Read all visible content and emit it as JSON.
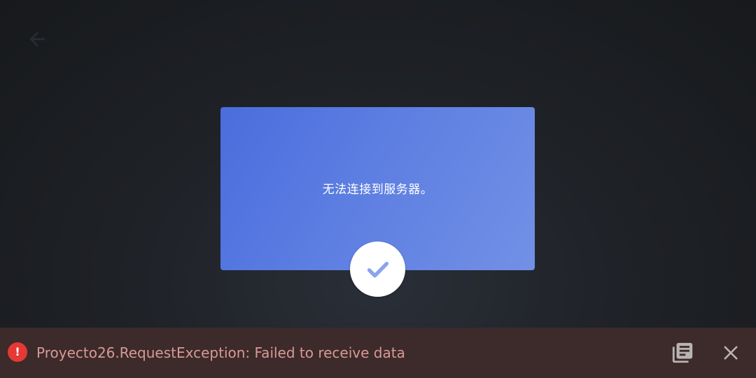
{
  "dialog": {
    "message": "无法连接到服务器。"
  },
  "error_bar": {
    "message": "Proyecto26.RequestException: Failed to receive data",
    "icon_glyph": "!"
  },
  "icons": {
    "back": "arrow-left-icon",
    "confirm": "checkmark-icon",
    "error": "error-icon",
    "details": "library-books-icon",
    "close": "close-icon"
  },
  "colors": {
    "dialog_start": "#4a6ddd",
    "dialog_end": "#7290e6",
    "checkmark": "#8aa4ec",
    "error_bar_bg": "#3d2a2a",
    "error_text": "#d79a96",
    "error_icon_bg": "#e53935"
  }
}
